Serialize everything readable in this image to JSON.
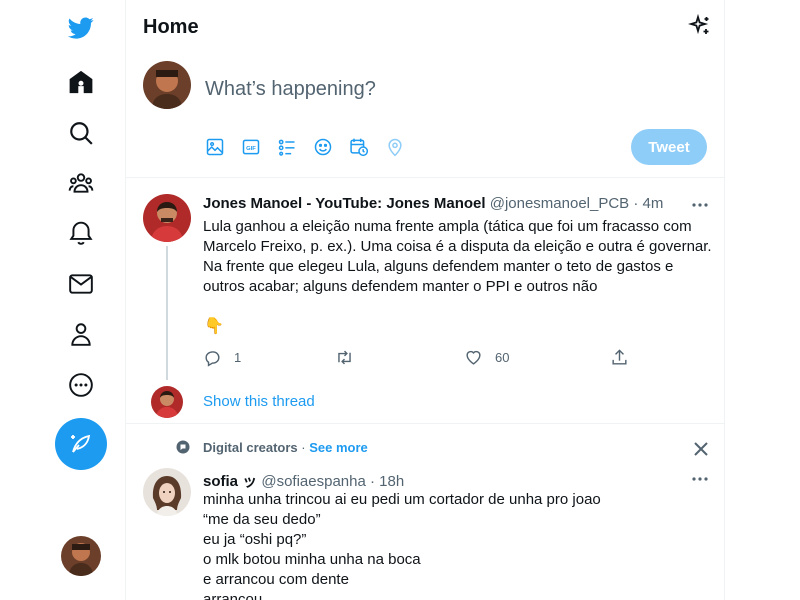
{
  "colors": {
    "accent": "#1d9bf0",
    "accent_disabled": "#8ecdf8",
    "text": "#0f1419",
    "muted": "#536471",
    "border": "#eff3f4"
  },
  "nav": {
    "items": [
      {
        "icon": "twitter-logo-icon"
      },
      {
        "icon": "home-icon"
      },
      {
        "icon": "explore-icon"
      },
      {
        "icon": "communities-icon"
      },
      {
        "icon": "notifications-icon"
      },
      {
        "icon": "messages-icon"
      },
      {
        "icon": "profile-icon"
      },
      {
        "icon": "more-icon"
      }
    ],
    "compose_icon": "feather-icon"
  },
  "header": {
    "title": "Home",
    "icon": "sparkle-icon"
  },
  "composer": {
    "placeholder": "What’s happening?",
    "tools": [
      "media-icon",
      "gif-icon",
      "poll-icon",
      "emoji-icon",
      "schedule-icon",
      "location-icon"
    ],
    "tweet_label": "Tweet"
  },
  "tweets": [
    {
      "name": "Jones Manoel - YouTube: Jones Manoel",
      "handle": "@jonesmanoel_PCB",
      "time": "· 4m",
      "text_lines": [
        "Lula ganhou a eleição numa frente ampla (tática que foi um fracasso com",
        "Marcelo Freixo, p. ex.). Uma coisa é a disputa da eleição e outra é governar.",
        "Na frente que elegeu Lula, alguns defendem manter o teto de gastos e",
        "outros acabar; alguns defendem manter o PPI e outros não"
      ],
      "emoji": "👇",
      "replies": "1",
      "retweets": "",
      "likes": "60",
      "show_thread": "Show this thread"
    },
    {
      "topic": "Digital creators",
      "topic_sep": " · ",
      "see_more": "See more",
      "name": "sofia ッ",
      "handle": "@sofiaespanha",
      "time": "· 18h",
      "text_lines": [
        "minha unha trincou ai eu pedi um cortador de unha pro joao",
        "“me da seu dedo”",
        "eu ja “oshi pq?”",
        "o mlk botou minha unha na boca",
        "e arrancou com dente",
        "arrancou"
      ]
    }
  ]
}
